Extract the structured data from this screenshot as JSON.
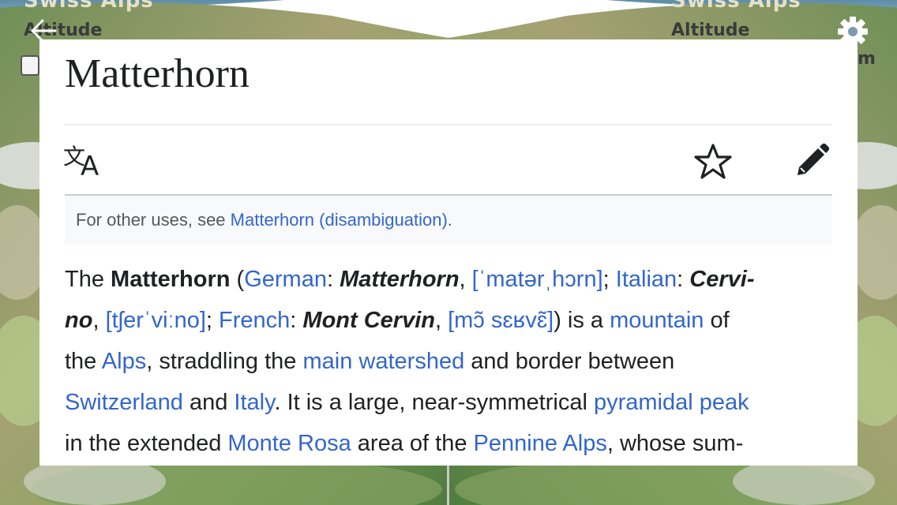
{
  "map": {
    "title_left": "Swiss Alps",
    "title_right": "Swiss Alps",
    "altitude_left": "Altitude",
    "altitude_right": "Altitude",
    "right_fragment": "m"
  },
  "icons": {
    "back": "arrow-left-icon",
    "settings": "gear-icon",
    "language": "translate-icon",
    "watch": "star-icon",
    "edit": "pencil-icon"
  },
  "article": {
    "title": "Matterhorn",
    "hatnote": {
      "prefix": "For other uses, see ",
      "link": "Matterhorn (disambiguation)",
      "suffix": "."
    },
    "lines": [
      [
        {
          "t": "The "
        },
        {
          "t": "Matterhorn",
          "s": "b"
        },
        {
          "t": " ("
        },
        {
          "t": "German",
          "s": "a"
        },
        {
          "t": ": "
        },
        {
          "t": "Matterhorn",
          "s": "bi"
        },
        {
          "t": ", "
        },
        {
          "t": "[ˈmatərˌhɔrn]",
          "s": "a"
        },
        {
          "t": "; "
        },
        {
          "t": "Italian",
          "s": "a"
        },
        {
          "t": ": "
        },
        {
          "t": "Cervi-",
          "s": "bi"
        }
      ],
      [
        {
          "t": "no",
          "s": "bi"
        },
        {
          "t": ", "
        },
        {
          "t": "[tʃerˈviːno]",
          "s": "a"
        },
        {
          "t": "; "
        },
        {
          "t": "French",
          "s": "a"
        },
        {
          "t": ": "
        },
        {
          "t": "Mont Cervin",
          "s": "bi"
        },
        {
          "t": ", "
        },
        {
          "t": "[mɔ̃ sɛʁvɛ̃]",
          "s": "a"
        },
        {
          "t": ") is a "
        },
        {
          "t": "mountain",
          "s": "a"
        },
        {
          "t": " of"
        }
      ],
      [
        {
          "t": "the "
        },
        {
          "t": "Alps",
          "s": "a"
        },
        {
          "t": ", straddling the "
        },
        {
          "t": "main watershed",
          "s": "a"
        },
        {
          "t": " and border between"
        }
      ],
      [
        {
          "t": "Switzerland",
          "s": "a"
        },
        {
          "t": " and "
        },
        {
          "t": "Italy",
          "s": "a"
        },
        {
          "t": ". It is a large, near-symmetrical "
        },
        {
          "t": "pyramidal peak",
          "s": "a"
        }
      ],
      [
        {
          "t": "in the extended "
        },
        {
          "t": "Monte Rosa",
          "s": "a"
        },
        {
          "t": " area of the "
        },
        {
          "t": "Pennine Alps",
          "s": "a"
        },
        {
          "t": ", whose sum-"
        }
      ]
    ]
  },
  "colors": {
    "link": "#3366cc",
    "text": "#202122",
    "hatnote_bg": "#f8f9fa",
    "hatnote_text": "#54595d"
  }
}
